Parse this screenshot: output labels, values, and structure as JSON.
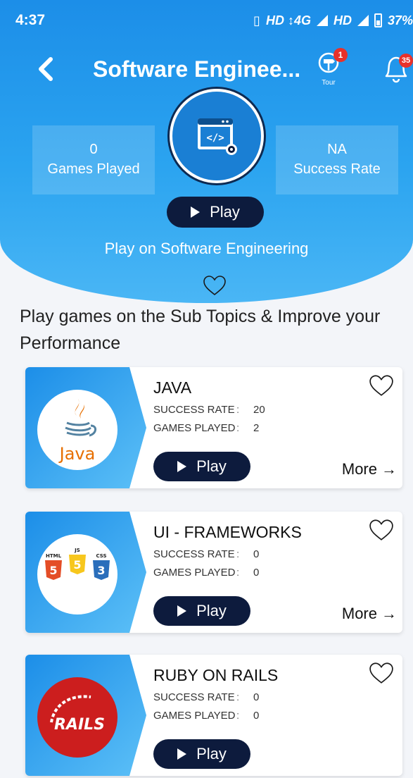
{
  "status_bar": {
    "time": "4:37",
    "network": "HD ↕4G",
    "network2": "HD",
    "battery": "37%"
  },
  "header": {
    "title": "Software Enginee...",
    "tour_label": "Tour",
    "tour_badge": "1",
    "notification_badge": "35"
  },
  "stats": {
    "games_played_value": "0",
    "games_played_label": "Games Played",
    "success_rate_value": "NA",
    "success_rate_label": "Success Rate"
  },
  "hero": {
    "play_label": "Play",
    "subtitle": "Play on Software Engineering"
  },
  "section_title": "Play games on the Sub Topics & Improve your Performance",
  "cards": [
    {
      "name": "JAVA",
      "success_label": "SUCCESS RATE",
      "success_value": "20",
      "games_label": "GAMES PLAYED",
      "games_value": "2",
      "play_label": "Play",
      "more_label": "More",
      "logo_text": "Java"
    },
    {
      "name": "UI - FRAMEWORKS",
      "success_label": "SUCCESS RATE",
      "success_value": "0",
      "games_label": "GAMES PLAYED",
      "games_value": "0",
      "play_label": "Play",
      "more_label": "More",
      "logo_html": "HTML",
      "logo_js": "JS",
      "logo_css": "CSS"
    },
    {
      "name": "RUBY ON RAILS",
      "success_label": "SUCCESS RATE",
      "success_value": "0",
      "games_label": "GAMES PLAYED",
      "games_value": "0",
      "play_label": "Play",
      "logo_text": "RAILS"
    }
  ],
  "colors": {
    "primary": "#1c8ee8",
    "dark": "#0d1b3d",
    "badge": "#e8312a"
  }
}
